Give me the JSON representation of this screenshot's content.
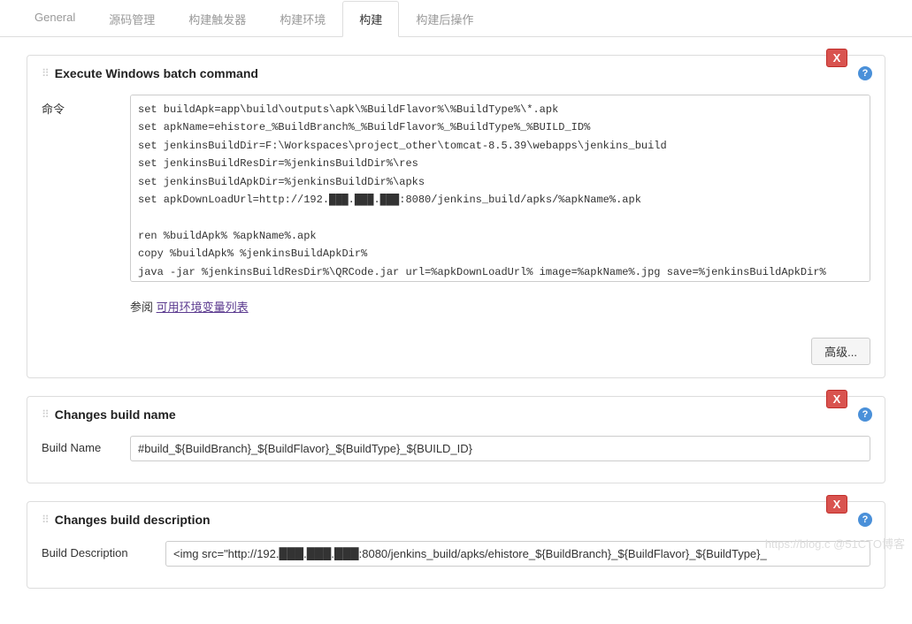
{
  "tabs": {
    "general": "General",
    "source": "源码管理",
    "triggers": "构建触发器",
    "env": "构建环境",
    "build": "构建",
    "post": "构建后操作"
  },
  "section_batch": {
    "title": "Execute Windows batch command",
    "label": "命令",
    "command": "set buildApk=app\\build\\outputs\\apk\\%BuildFlavor%\\%BuildType%\\*.apk\nset apkName=ehistore_%BuildBranch%_%BuildFlavor%_%BuildType%_%BUILD_ID%\nset jenkinsBuildDir=F:\\Workspaces\\project_other\\tomcat-8.5.39\\webapps\\jenkins_build\nset jenkinsBuildResDir=%jenkinsBuildDir%\\res\nset jenkinsBuildApkDir=%jenkinsBuildDir%\\apks\nset apkDownLoadUrl=http://192.███.███.███:8080/jenkins_build/apks/%apkName%.apk\n\nren %buildApk% %apkName%.apk\ncopy %buildApk% %jenkinsBuildApkDir%\njava -jar %jenkinsBuildResDir%\\QRCode.jar url=%apkDownLoadUrl% image=%apkName%.jpg save=%jenkinsBuildApkDir%",
    "refer_prefix": "参阅 ",
    "refer_link": "可用环境变量列表",
    "advanced": "高级..."
  },
  "section_build_name": {
    "title": "Changes build name",
    "label": "Build Name",
    "value": "#build_${BuildBranch}_${BuildFlavor}_${BuildType}_${BUILD_ID}"
  },
  "section_build_desc": {
    "title": "Changes build description",
    "label": "Build Description",
    "value": "<img src=\"http://192.███.███.███:8080/jenkins_build/apks/ehistore_${BuildBranch}_${BuildFlavor}_${BuildType}_"
  },
  "delete_label": "X",
  "help_label": "?",
  "watermark": "https://blog.c   @51CTO博客"
}
